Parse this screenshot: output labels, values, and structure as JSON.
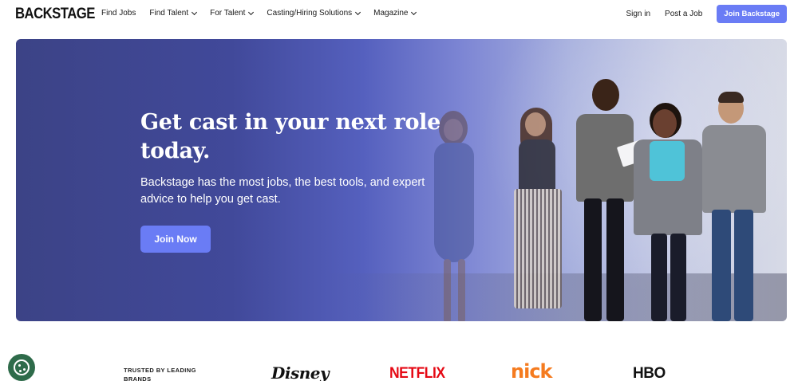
{
  "nav": {
    "logo": "BACKSTAGE",
    "links": [
      {
        "label": "Find Jobs",
        "has_dropdown": false
      },
      {
        "label": "Find Talent",
        "has_dropdown": true
      },
      {
        "label": "For Talent",
        "has_dropdown": true
      },
      {
        "label": "Casting/Hiring Solutions",
        "has_dropdown": true
      },
      {
        "label": "Magazine",
        "has_dropdown": true
      }
    ],
    "sign_in": "Sign in",
    "post_job": "Post a Job",
    "join": "Join Backstage"
  },
  "hero": {
    "title": "Get cast in your next role today.",
    "subtitle": "Backstage has the most jobs, the best tools, and expert advice to help you get cast.",
    "cta": "Join Now"
  },
  "trusted": {
    "label": "TRUSTED BY LEADING BRANDS",
    "brands": [
      "Disney",
      "NETFLIX",
      "nick",
      "HBO"
    ]
  },
  "colors": {
    "accent": "#6a7cf5",
    "hero_dark": "#3c4386",
    "cookie": "#2e6b4a",
    "netflix": "#e50914",
    "nick": "#f57b1f"
  },
  "icons": [
    "chevron-down-icon",
    "cookie-icon"
  ]
}
